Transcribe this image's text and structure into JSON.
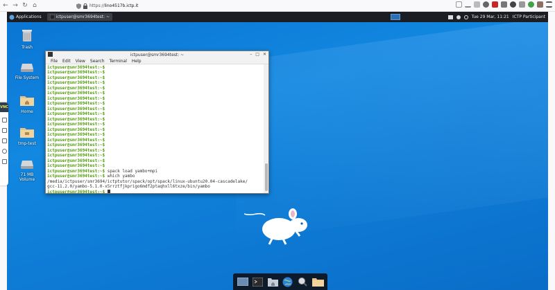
{
  "browser": {
    "url_prefix": "https://",
    "url_host": "lino4517b.ictp.it",
    "nav_back": "←",
    "nav_forward": "→",
    "nav_reload": "↻",
    "nav_home": "⌂"
  },
  "panel": {
    "applications_label": "Applications",
    "task_label": "ictpuser@smr3694test: ~",
    "datetime": "Tue 29 Mar, 11:21",
    "user": "ICTP Participant"
  },
  "desktop_icons": [
    {
      "label": "Trash"
    },
    {
      "label": "File System"
    },
    {
      "label": "Home"
    },
    {
      "label": "tmp-test"
    },
    {
      "label": "71 MB Volume"
    }
  ],
  "terminal": {
    "title": "ictpuser@smr3694test: ~",
    "menu": [
      "File",
      "Edit",
      "View",
      "Search",
      "Terminal",
      "Help"
    ],
    "prompt": "ictpuser@smr3694test:~$",
    "lines": [
      {
        "prompt": "ictpuser@smr3694test:~$",
        "text": ""
      },
      {
        "prompt": "ictpuser@smr3694test:~$",
        "text": ""
      },
      {
        "prompt": "ictpuser@smr3694test:~$",
        "text": ""
      },
      {
        "prompt": "ictpuser@smr3694test:~$",
        "text": ""
      },
      {
        "prompt": "ictpuser@smr3694test:~$",
        "text": ""
      },
      {
        "prompt": "ictpuser@smr3694test:~$",
        "text": ""
      },
      {
        "prompt": "ictpuser@smr3694test:~$",
        "text": ""
      },
      {
        "prompt": "ictpuser@smr3694test:~$",
        "text": ""
      },
      {
        "prompt": "ictpuser@smr3694test:~$",
        "text": ""
      },
      {
        "prompt": "ictpuser@smr3694test:~$",
        "text": ""
      },
      {
        "prompt": "ictpuser@smr3694test:~$",
        "text": ""
      },
      {
        "prompt": "ictpuser@smr3694test:~$",
        "text": ""
      },
      {
        "prompt": "ictpuser@smr3694test:~$",
        "text": ""
      },
      {
        "prompt": "ictpuser@smr3694test:~$",
        "text": ""
      },
      {
        "prompt": "ictpuser@smr3694test:~$",
        "text": ""
      },
      {
        "prompt": "ictpuser@smr3694test:~$",
        "text": ""
      },
      {
        "prompt": "ictpuser@smr3694test:~$",
        "text": ""
      },
      {
        "prompt": "ictpuser@smr3694test:~$",
        "text": ""
      },
      {
        "prompt": "ictpuser@smr3694test:~$",
        "text": ""
      },
      {
        "prompt": "ictpuser@smr3694test:~$",
        "text": ""
      },
      {
        "prompt": "ictpuser@smr3694test:~$",
        "text": " spack load yambo+mpi"
      },
      {
        "prompt": "ictpuser@smr3694test:~$",
        "text": " which yambo"
      },
      {
        "prompt": "",
        "text": "/media/ictpuser/smr3694/ictptutor/spack/opt/spack/linux-ubuntu20.04-cascadelake/"
      },
      {
        "prompt": "",
        "text": "gcc-11.2.0/yambo-5.1.0-x5rrztfjkprigo6mdf2ptaqhxll6txze/bin/yambo"
      },
      {
        "prompt": "ictpuser@smr3694test:~$",
        "text": " "
      }
    ]
  },
  "colors": {
    "desktop": "#0a74d3",
    "panel": "#1b1d22",
    "prompt": "#4e9a06"
  },
  "icons": {
    "vnc_label": "VNC"
  }
}
